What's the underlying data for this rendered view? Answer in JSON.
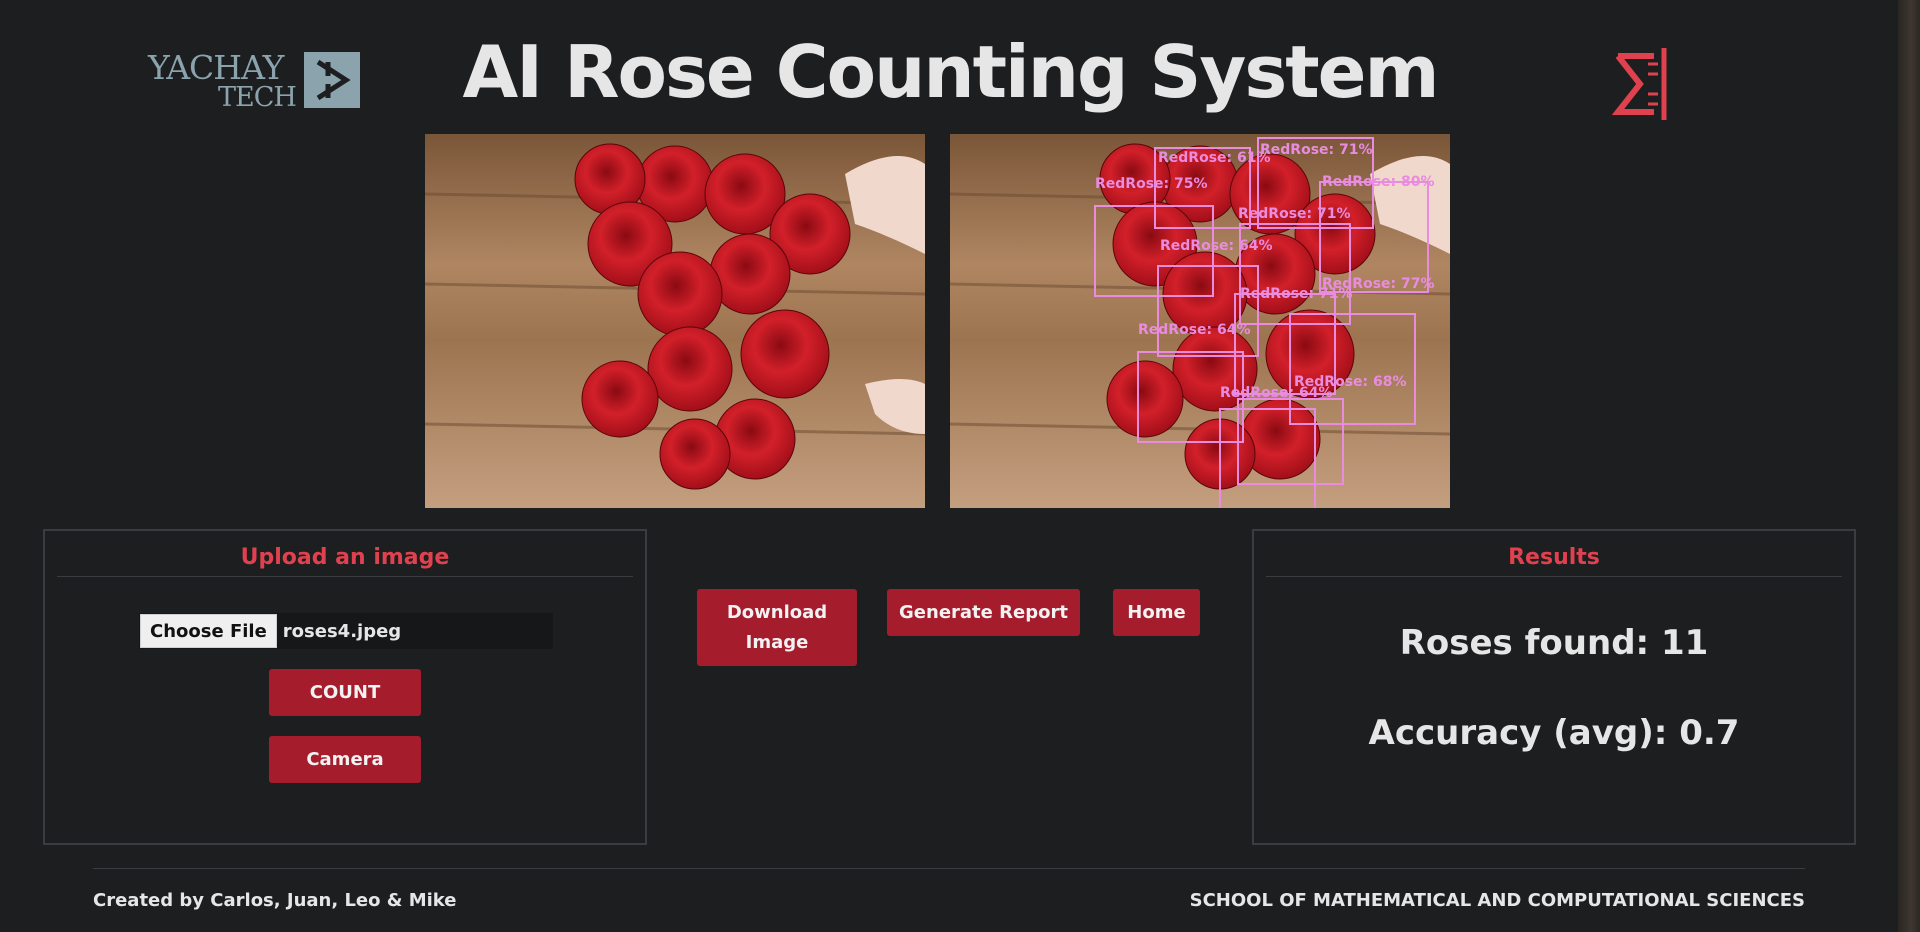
{
  "header": {
    "title": "AI Rose Counting System",
    "logo_left_line1": "YACHAY",
    "logo_left_line2": "TECH",
    "logo_left_icon": "yachay-tech-logo-icon",
    "logo_right_icon": "school-logo-icon"
  },
  "images": {
    "original_icon": "rose-bouquet-photo",
    "detected_icon": "rose-bouquet-detections-photo",
    "detection_labels": [
      "RedRose: 61%",
      "RedRose: 71%",
      "RedRose: 75%",
      "RedRose: 80%",
      "RedRose: 71%",
      "RedRose: 64%",
      "RedRose: 71%",
      "RedRose: 77%",
      "RedRose: 64%",
      "RedRose: 68%",
      "RedRose: 64%"
    ]
  },
  "upload": {
    "heading": "Upload an image",
    "choose_file_label": "Choose File",
    "file_name": "roses4.jpeg",
    "count_label": "COUNT",
    "camera_label": "Camera"
  },
  "actions": {
    "download_label": "Download\nImage",
    "report_label": "Generate Report",
    "home_label": "Home"
  },
  "results": {
    "heading": "Results",
    "roses_found": "Roses found: 11",
    "accuracy": "Accuracy (avg): 0.7"
  },
  "footer": {
    "credits": "Created by Carlos, Juan, Leo & Mike",
    "school": "SCHOOL OF MATHEMATICAL AND COMPUTATIONAL SCIENCES"
  },
  "colors": {
    "background": "#1d1e20",
    "accent_red": "#a51c2c",
    "heading_red": "#e0414f",
    "detection_box": "#e98ce0"
  }
}
